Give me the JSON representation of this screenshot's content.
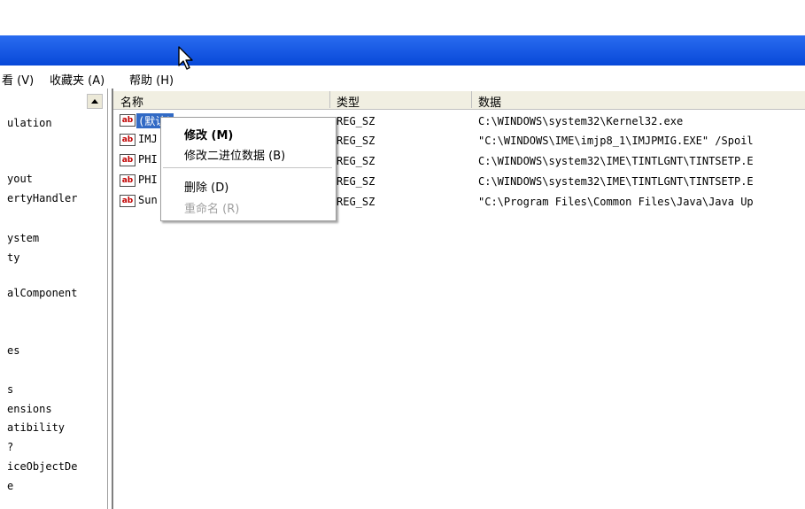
{
  "menu": {
    "view": "看 (V)",
    "favorites": "收藏夹 (A)",
    "help": "帮助 (H)"
  },
  "tree": {
    "nodes": [
      "ulation",
      "yout",
      "ertyHandler",
      "ystem",
      "ty",
      "alComponent",
      "es",
      "s",
      "ensions",
      "atibility",
      "?",
      "iceObjectDe",
      "e"
    ]
  },
  "columns": {
    "name": "名称",
    "type": "类型",
    "data": "数据"
  },
  "rows": [
    {
      "icon": "ab",
      "name": "(默认)",
      "type": "REG_SZ",
      "data": "C:\\WINDOWS\\system32\\Kernel32.exe"
    },
    {
      "icon": "ab",
      "name": "IMJ",
      "type": "REG_SZ",
      "data": "\"C:\\WINDOWS\\IME\\imjp8_1\\IMJPMIG.EXE\" /Spoil"
    },
    {
      "icon": "ab",
      "name": "PHI",
      "type": "REG_SZ",
      "data": "C:\\WINDOWS\\system32\\IME\\TINTLGNT\\TINTSETP.E"
    },
    {
      "icon": "ab",
      "name": "PHI",
      "type": "REG_SZ",
      "data": "C:\\WINDOWS\\system32\\IME\\TINTLGNT\\TINTSETP.E"
    },
    {
      "icon": "ab",
      "name": "Sun",
      "type": "REG_SZ",
      "data": "\"C:\\Program Files\\Common Files\\Java\\Java Up"
    }
  ],
  "context_menu": {
    "modify": "修改 (M)",
    "modify_binary": "修改二进位数据 (B)",
    "delete": "删除 (D)",
    "rename": "重命名 (R)"
  },
  "colors": {
    "titlebar": "#0a50e0",
    "selection": "#316ac5"
  }
}
